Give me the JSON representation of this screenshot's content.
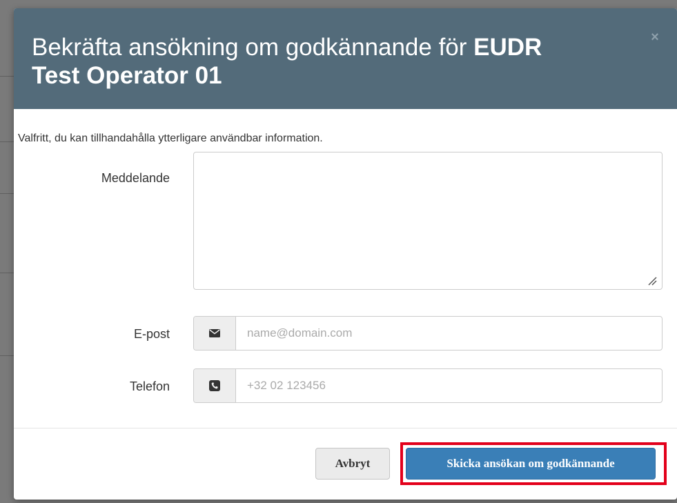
{
  "modal": {
    "title_prefix": "Bekräfta ansökning om godkännande för ",
    "title_operator": "EUDR Test Operator 01",
    "close_glyph": "×"
  },
  "form": {
    "hint": "Valfritt, du kan tillhandahålla ytterligare användbar information.",
    "message_label": "Meddelande",
    "message_value": "",
    "email_label": "E-post",
    "email_icon": "envelope-icon",
    "email_placeholder": "name@domain.com",
    "phone_label": "Telefon",
    "phone_icon": "phone-square-icon",
    "phone_placeholder": "+32 02 123456"
  },
  "footer": {
    "cancel_label": "Avbryt",
    "submit_label": "Skicka ansökan om godkännande"
  },
  "colors": {
    "header_bg": "#536b7a",
    "primary": "#3a7fb7",
    "highlight": "#e3001b"
  }
}
